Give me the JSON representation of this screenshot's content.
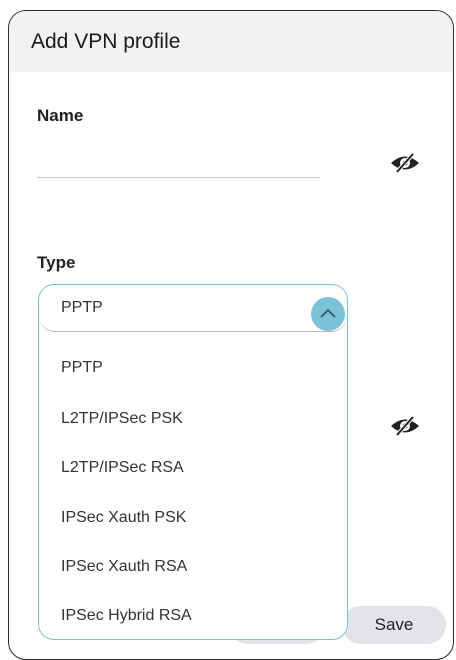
{
  "dialog": {
    "title": "Add VPN profile"
  },
  "name_field": {
    "label": "Name",
    "value": ""
  },
  "type_field": {
    "label": "Type",
    "selected": "PPTP",
    "options": [
      "PPTP",
      "L2TP/IPSec PSK",
      "L2TP/IPSec RSA",
      "IPSec Xauth PSK",
      "IPSec Xauth RSA",
      "IPSec Hybrid RSA"
    ]
  },
  "buttons": {
    "cancel": "",
    "save": "Save"
  },
  "icons": {
    "password_toggle": "eye-slash-icon",
    "dropdown_toggle": "chevron-up-icon"
  },
  "colors": {
    "accent": "#7cc3d9",
    "header_bg": "#f2f2f2",
    "button_bg": "#e3e3ea"
  }
}
